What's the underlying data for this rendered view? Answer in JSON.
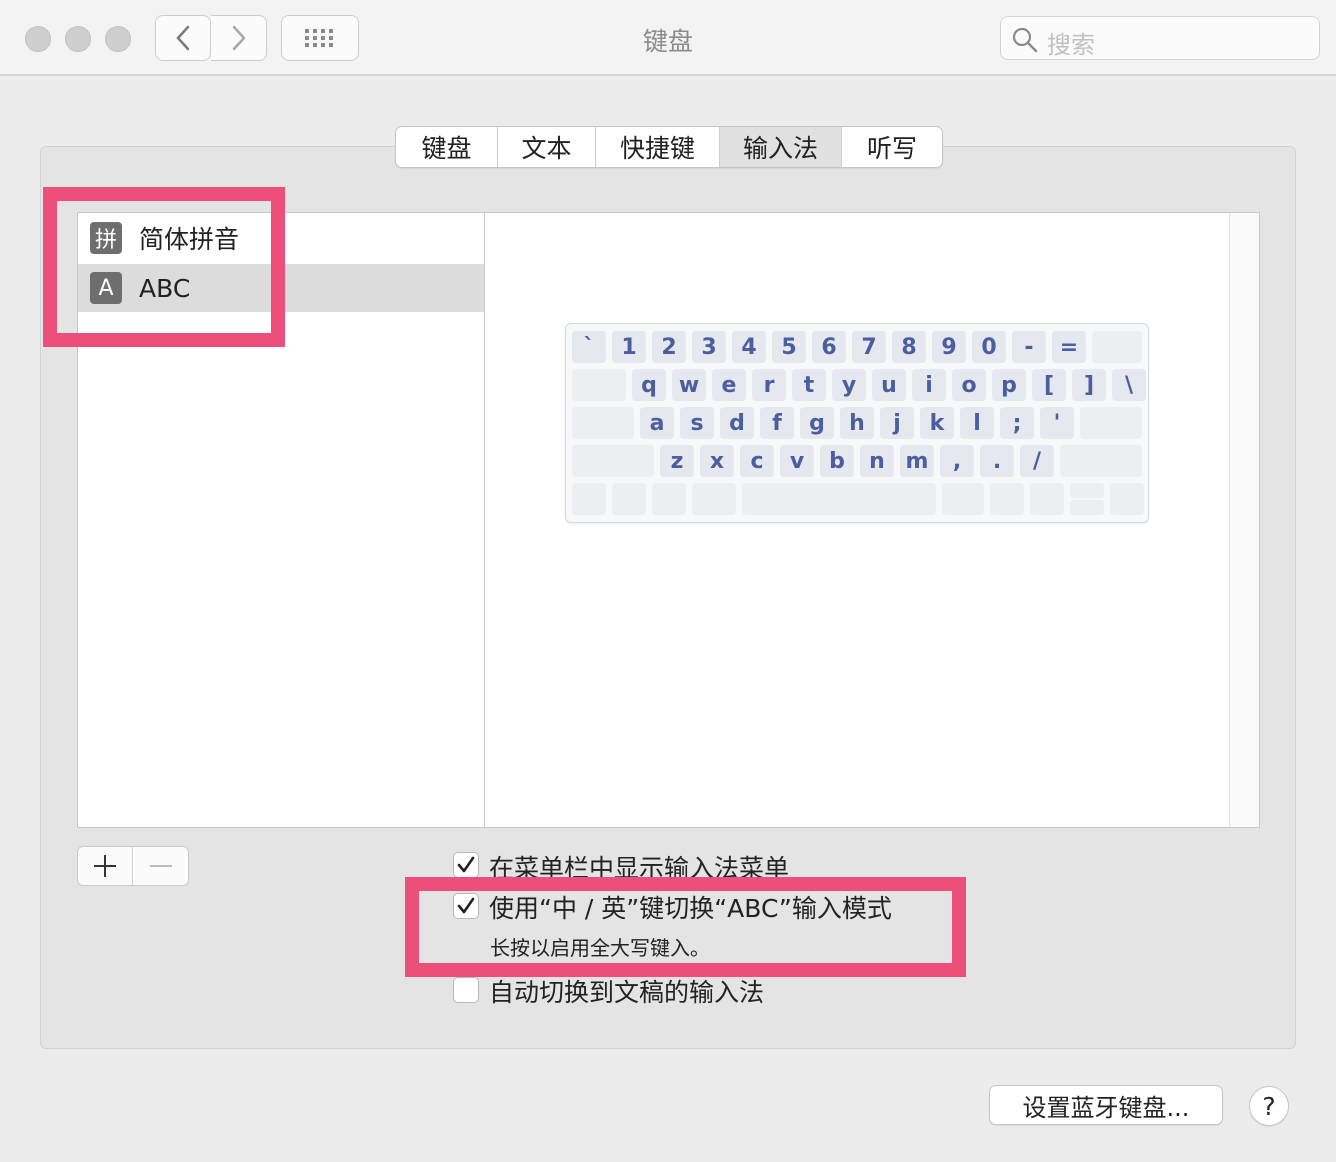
{
  "window": {
    "title": "键盘",
    "search_placeholder": "搜索"
  },
  "tabs": [
    {
      "label": "键盘",
      "active": false
    },
    {
      "label": "文本",
      "active": false
    },
    {
      "label": "快捷键",
      "active": false
    },
    {
      "label": "输入法",
      "active": true
    },
    {
      "label": "听写",
      "active": false
    }
  ],
  "input_sources": [
    {
      "icon_glyph": "拼",
      "label": "简体拼音",
      "selected": false
    },
    {
      "icon_glyph": "A",
      "label": "ABC",
      "selected": true
    }
  ],
  "keyboard": {
    "row1": [
      "`",
      "1",
      "2",
      "3",
      "4",
      "5",
      "6",
      "7",
      "8",
      "9",
      "0",
      "-",
      "="
    ],
    "row2": [
      "q",
      "w",
      "e",
      "r",
      "t",
      "y",
      "u",
      "i",
      "o",
      "p",
      "[",
      "]",
      "\\"
    ],
    "row3": [
      "a",
      "s",
      "d",
      "f",
      "g",
      "h",
      "j",
      "k",
      "l",
      ";",
      "'"
    ],
    "row4": [
      "z",
      "x",
      "c",
      "v",
      "b",
      "n",
      "m",
      ",",
      ".",
      "/"
    ]
  },
  "list_controls": {
    "add": "+",
    "remove": "—"
  },
  "options": [
    {
      "label": "在菜单栏中显示输入法菜单",
      "checked": true
    },
    {
      "label": "使用“中 / 英”键切换“ABC”输入模式",
      "checked": true
    },
    {
      "label": "自动切换到文稿的输入法",
      "checked": false
    }
  ],
  "option_hint": "长按以启用全大写键入。",
  "bottom": {
    "bluetooth_button": "设置蓝牙键盘...",
    "help": "?"
  },
  "colors": {
    "highlight": "#ed4f7b",
    "key_text": "#4a5ea0"
  }
}
